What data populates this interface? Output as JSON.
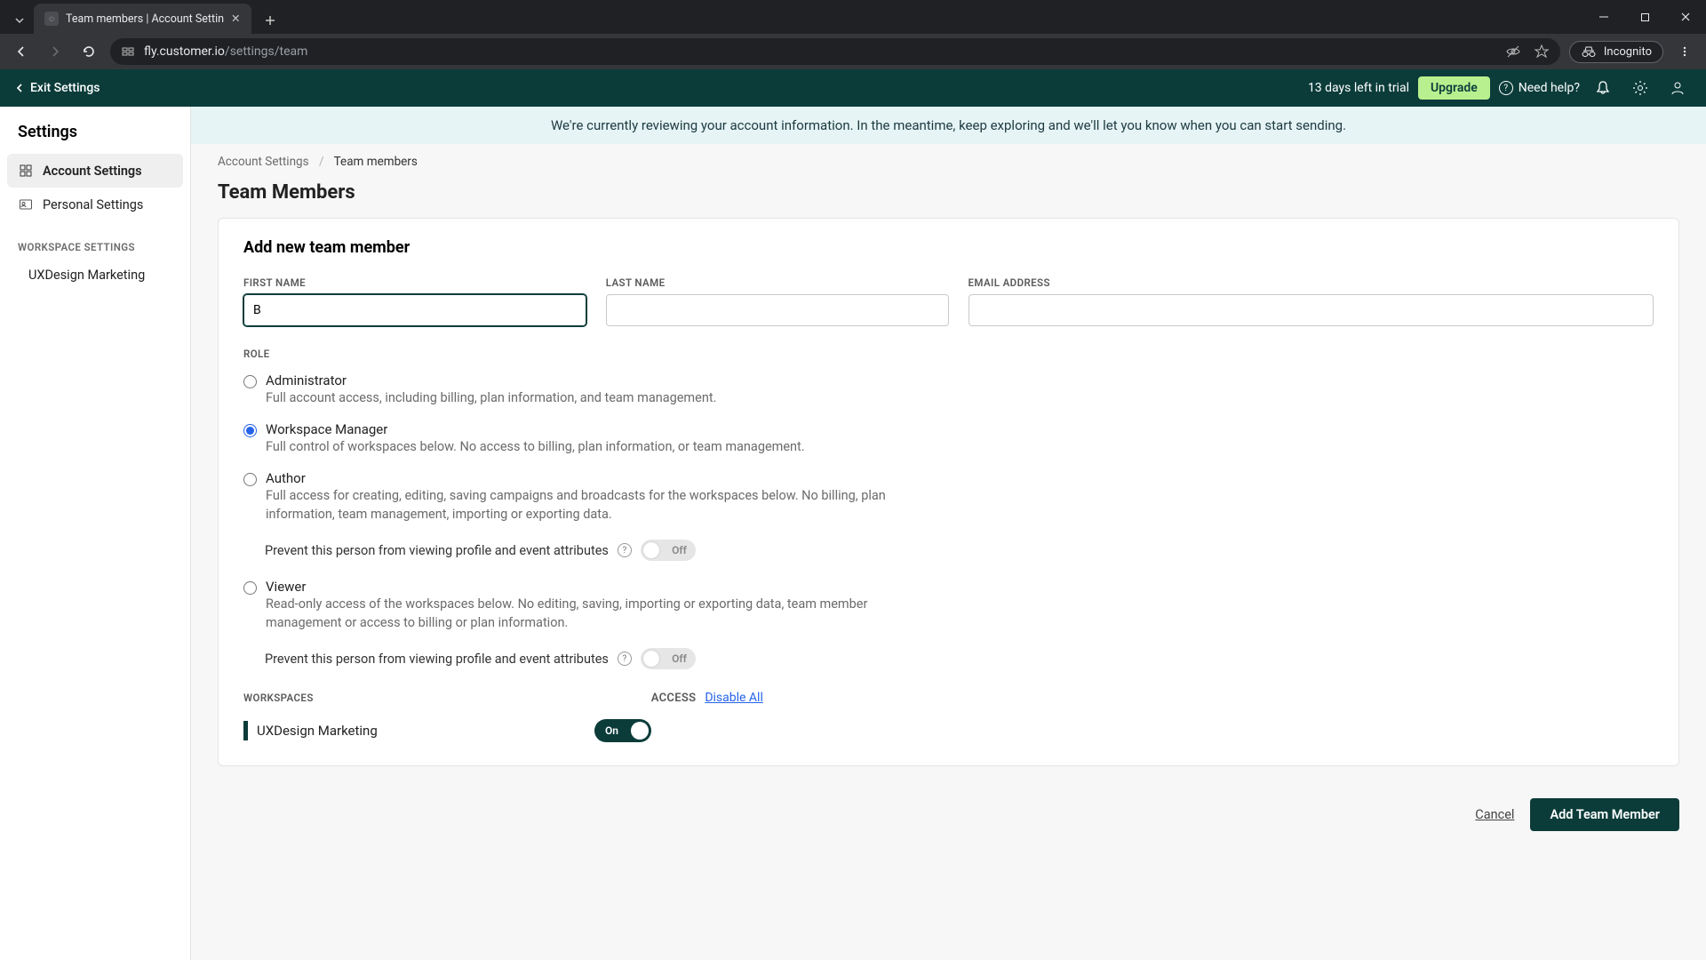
{
  "browser": {
    "tab_title": "Team members | Account Settin",
    "url_host": "fly.customer.io",
    "url_path": "/settings/team",
    "incognito_label": "Incognito"
  },
  "header": {
    "exit_label": "Exit Settings",
    "trial_text": "13 days left in trial",
    "upgrade_label": "Upgrade",
    "help_label": "Need help?"
  },
  "sidebar": {
    "title": "Settings",
    "items": [
      {
        "label": "Account Settings",
        "active": true
      },
      {
        "label": "Personal Settings",
        "active": false
      }
    ],
    "workspace_section_label": "WORKSPACE SETTINGS",
    "workspaces": [
      "UXDesign Marketing"
    ]
  },
  "banner": "We're currently reviewing your account information. In the meantime, keep exploring and we'll let you know when you can start sending.",
  "breadcrumbs": {
    "root": "Account Settings",
    "current": "Team members"
  },
  "page_title": "Team Members",
  "form": {
    "heading": "Add new team member",
    "first_name_label": "FIRST NAME",
    "first_name_value": "B",
    "last_name_label": "LAST NAME",
    "last_name_value": "",
    "email_label": "EMAIL ADDRESS",
    "email_value": "",
    "role_label": "ROLE",
    "roles": [
      {
        "title": "Administrator",
        "desc": "Full account access, including billing, plan information, and team management.",
        "selected": false
      },
      {
        "title": "Workspace Manager",
        "desc": "Full control of workspaces below. No access to billing, plan information, or team management.",
        "selected": true
      },
      {
        "title": "Author",
        "desc": "Full access for creating, editing, saving campaigns and broadcasts for the workspaces below. No billing, plan information, team management, importing or exporting data.",
        "selected": false
      },
      {
        "title": "Viewer",
        "desc": "Read-only access of the workspaces below. No editing, saving, importing or exporting data, team member management or access to billing or plan information.",
        "selected": false
      }
    ],
    "prevent_label": "Prevent this person from viewing profile and event attributes",
    "toggle_off_label": "Off",
    "workspaces_label": "WORKSPACES",
    "access_label": "ACCESS",
    "disable_all_label": "Disable All",
    "workspace_rows": [
      {
        "name": "UXDesign Marketing",
        "on": true
      }
    ],
    "toggle_on_label": "On",
    "cancel_label": "Cancel",
    "submit_label": "Add Team Member"
  }
}
